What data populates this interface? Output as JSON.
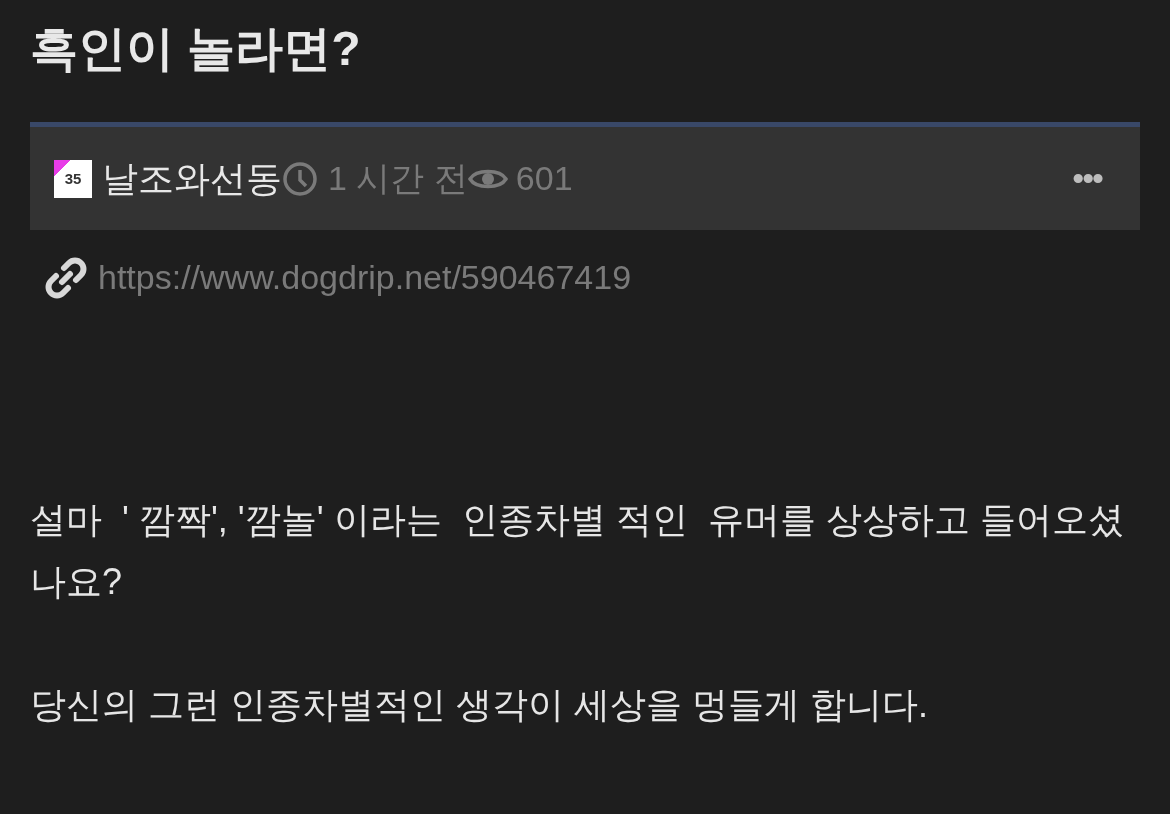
{
  "title": "흑인이 놀라면?",
  "meta": {
    "level_badge": "35",
    "author": "날조와선동",
    "time": "1 시간 전",
    "views": "601",
    "more": "•••"
  },
  "link": "https://www.dogdrip.net/590467419",
  "paragraphs": [
    "설마  ' 깜짝', '깜놀' 이라는  인종차별 적인  유머를 상상하고 들어오셨나요?",
    "당신의 그런 인종차별적인 생각이 세상을 멍들게 합니다."
  ]
}
